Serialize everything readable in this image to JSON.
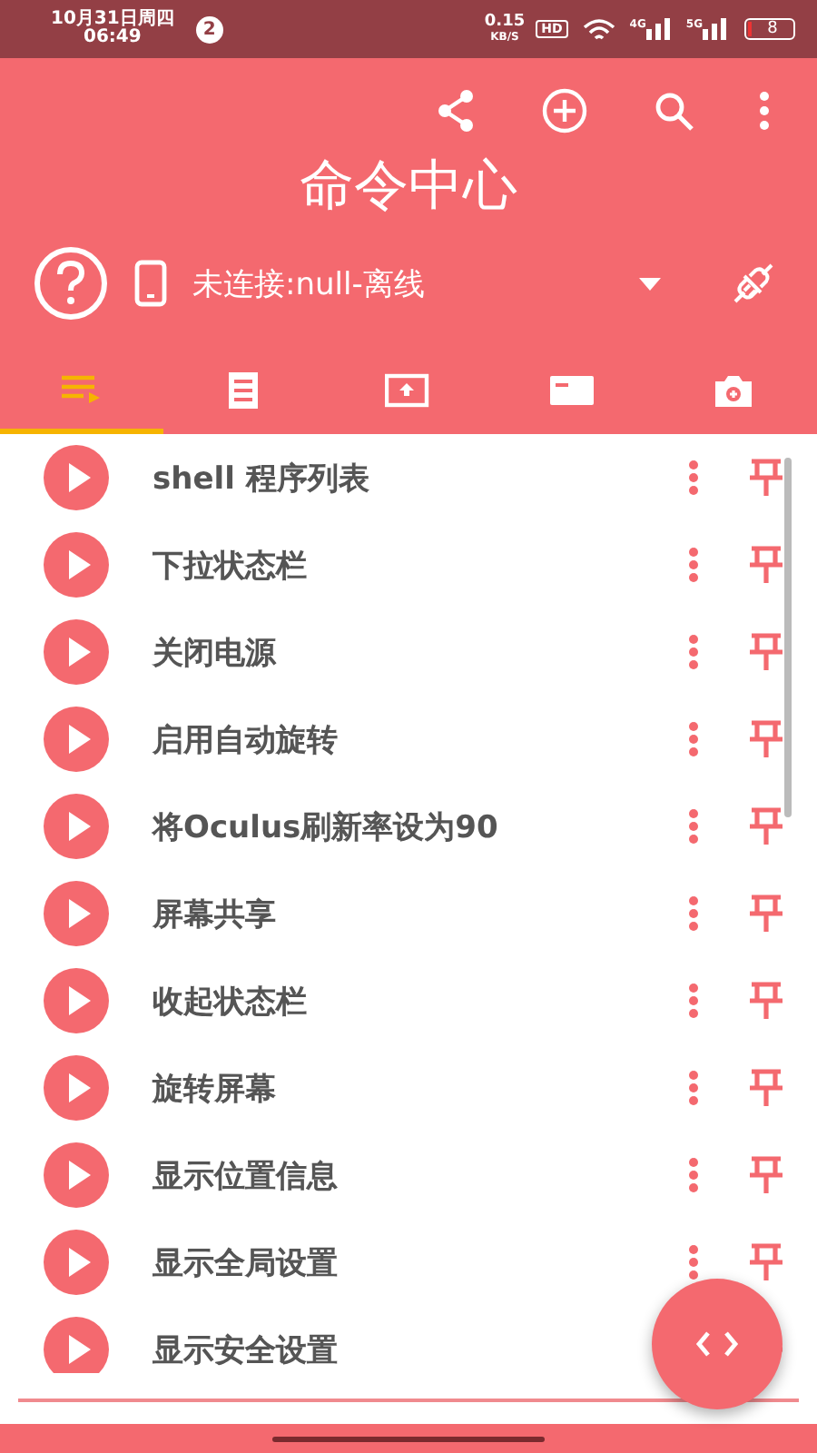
{
  "status_bar": {
    "date": "10月31日周四",
    "time": "06:49",
    "notification_count": "2",
    "speed": "0.15",
    "speed_unit": "KB/S",
    "hd": "HD",
    "network_1": "4G",
    "network_2": "5G",
    "battery": "8"
  },
  "header": {
    "title": "命令中心",
    "connection": "未连接:null-离线"
  },
  "tabs": [
    {
      "selected": true
    },
    {
      "selected": false
    },
    {
      "selected": false
    },
    {
      "selected": false
    },
    {
      "selected": false
    }
  ],
  "commands": [
    {
      "title": "shell 程序列表"
    },
    {
      "title": "下拉状态栏"
    },
    {
      "title": "关闭电源"
    },
    {
      "title": "启用自动旋转"
    },
    {
      "title": "将Oculus刷新率设为90"
    },
    {
      "title": "屏幕共享"
    },
    {
      "title": "收起状态栏"
    },
    {
      "title": "旋转屏幕"
    },
    {
      "title": "显示位置信息"
    },
    {
      "title": "显示全局设置"
    },
    {
      "title": "显示安全设置"
    }
  ]
}
